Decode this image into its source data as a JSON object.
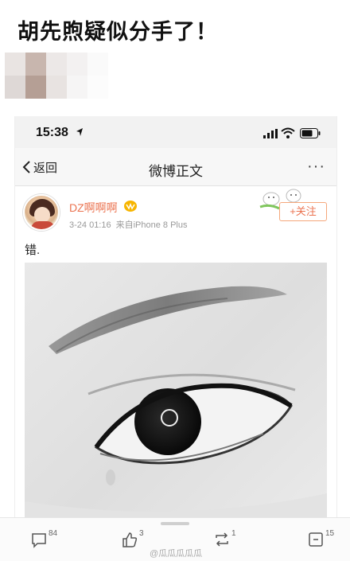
{
  "headline": "胡先煦疑似分手了！",
  "status_bar": {
    "time": "15:38",
    "icons": [
      "location-arrow-icon",
      "cellular-signal-icon",
      "wifi-icon",
      "battery-icon"
    ]
  },
  "nav": {
    "back_label": "返回",
    "title": "微博正文",
    "more_label": "···"
  },
  "post": {
    "username": "DZ啊啊啊",
    "date": "3-24 01:16",
    "source": "来自iPhone 8 Plus",
    "follow_label": "+关注",
    "text": "错.",
    "image": "black-and-white-eye-closeup"
  },
  "actions": {
    "comment_count": "84",
    "like_count": "3",
    "repost_count": "1",
    "share_count": "15"
  },
  "watermark": "@瓜瓜瓜瓜瓜",
  "colors": {
    "accent": "#eb7350",
    "follow_border": "#f5a77b",
    "meta": "#999999",
    "status_bg": "#f2f2f2"
  }
}
